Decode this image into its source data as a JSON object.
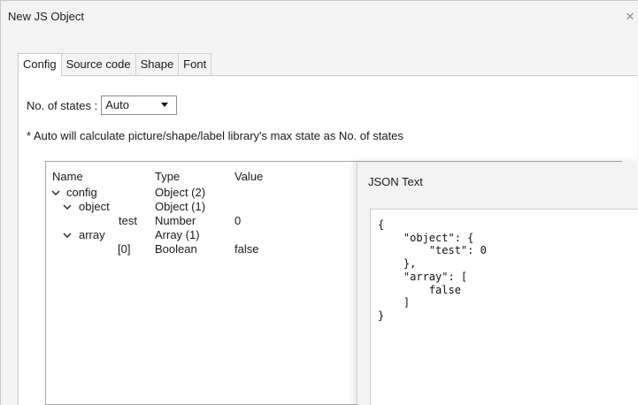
{
  "window": {
    "title": "New JS Object",
    "close_glyph": "×"
  },
  "tabs": [
    {
      "label": "Config",
      "active": true
    },
    {
      "label": "Source code",
      "active": false
    },
    {
      "label": "Shape",
      "active": false
    },
    {
      "label": "Font",
      "active": false
    }
  ],
  "config": {
    "states_label": "No. of states :",
    "states_value": "Auto",
    "note": "* Auto will calculate picture/shape/label library's max state as No. of states"
  },
  "tree": {
    "columns": [
      "Name",
      "Type",
      "Value"
    ],
    "rows": [
      {
        "name": "config",
        "type": "Object (2)",
        "value": "",
        "expanded": true
      },
      {
        "name": "object",
        "type": "Object (1)",
        "value": "",
        "expanded": true
      },
      {
        "name": "test",
        "type": "Number",
        "value": "0",
        "expanded": false
      },
      {
        "name": "array",
        "type": "Array (1)",
        "value": "",
        "expanded": true
      },
      {
        "name": "[0]",
        "type": "Boolean",
        "value": "false",
        "expanded": false
      }
    ]
  },
  "json_panel": {
    "title": "JSON Text",
    "text": "{\n    \"object\": {\n        \"test\": 0\n    },\n    \"array\": [\n        false\n    ]\n}"
  },
  "icons": {
    "expand": "chevron-down-icon",
    "close": "close-icon",
    "dropdown": "dropdown-arrow-icon"
  }
}
